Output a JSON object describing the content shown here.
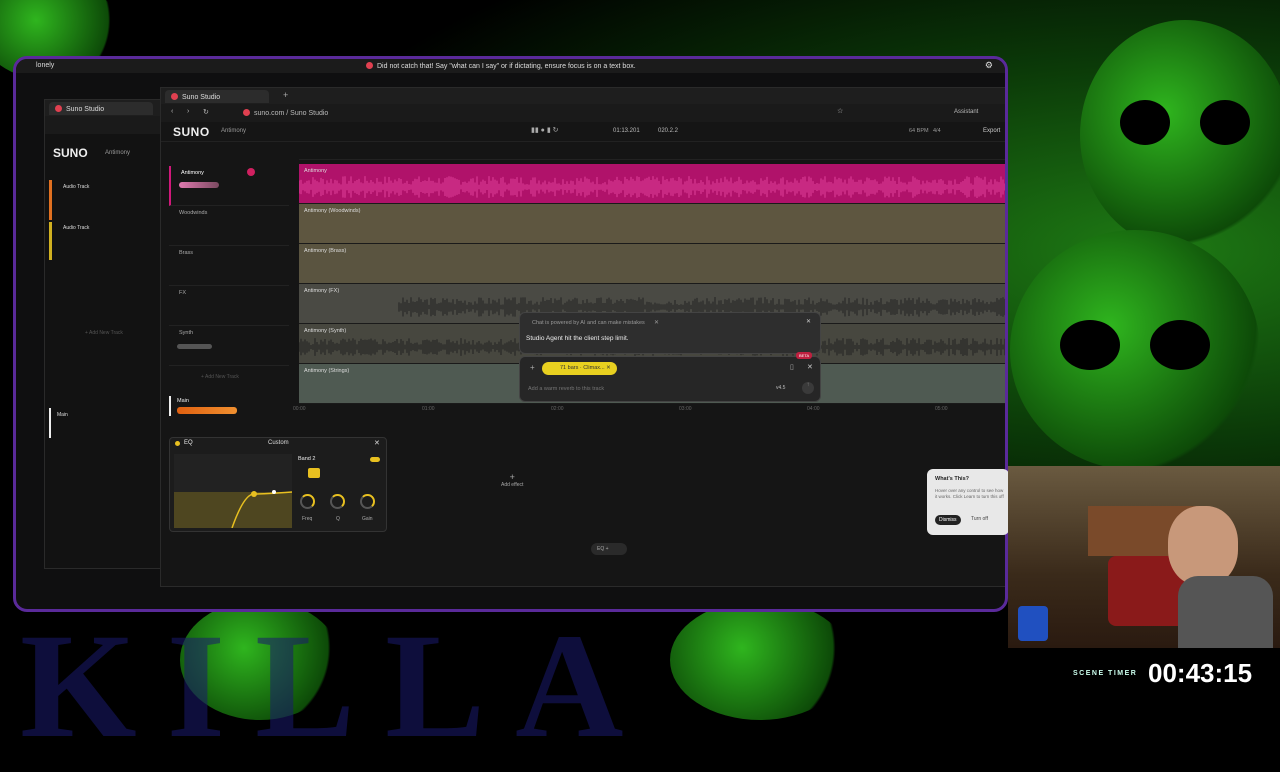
{
  "overlay": {
    "user": "lonely",
    "dictation_msg": "Did not catch that! Say \"what can I say\" or if dictating, ensure focus is on a text box.",
    "background_text": "KILLA"
  },
  "win2": {
    "tab": "Suno Studio",
    "logo": "SUNO",
    "project": "Antimony",
    "tracks": [
      "Audio Track",
      "Audio Track"
    ],
    "add_track": "+ Add New Track",
    "main": "Main"
  },
  "browser": {
    "tab": "Suno Studio",
    "url": "suno.com / Suno Studio",
    "assistant": "Assistant"
  },
  "app": {
    "logo": "SUNO",
    "project": "Antimony",
    "time": "01:13.201",
    "bars": "020.2.2",
    "bpm": "64 BPM",
    "meter": "4/4",
    "export": "Export"
  },
  "tracks": [
    {
      "name": "Antimony",
      "lane": "Antimony",
      "color": "#d0187a"
    },
    {
      "name": "Woodwinds",
      "lane": "Antimony (Woodwinds)",
      "color": "#5e5640"
    },
    {
      "name": "Brass",
      "lane": "Antimony (Brass)",
      "color": "#5e5640"
    },
    {
      "name": "FX",
      "lane": "Antimony (FX)",
      "color": "#4a4a44"
    },
    {
      "name": "Synth",
      "lane": "Antimony (Synth)",
      "color": "#4a4a44"
    },
    {
      "name": "",
      "lane": "Antimony (Strings)",
      "color": "#4f5a52"
    }
  ],
  "add_track": "+ Add New Track",
  "main_label": "Main",
  "timeline_ticks": [
    "00:00",
    "01:00",
    "02:00",
    "03:00",
    "04:00",
    "05:00"
  ],
  "chat": {
    "disclaimer": "Chat is powered by AI and can make mistakes",
    "agent_msg": "Studio Agent hit the client step limit.",
    "chip": "71 bars · Climax...",
    "placeholder": "Add a warm reverb to this track",
    "version": "v4.5",
    "beta": "BETA"
  },
  "eq": {
    "title": "EQ",
    "preset": "Custom",
    "band": "Band 2",
    "knobs": [
      "Freq",
      "Q",
      "Gain"
    ]
  },
  "add_effect": "Add effect",
  "bottom_eq": "EQ",
  "popup": {
    "title": "What's This?",
    "body": "Hover over any control to see how it works. Click Learn to turn this off",
    "dismiss": "Dismiss",
    "turnoff": "Turn off"
  },
  "timer": {
    "label": "SCENE TIMER",
    "value": "00:43:15"
  }
}
